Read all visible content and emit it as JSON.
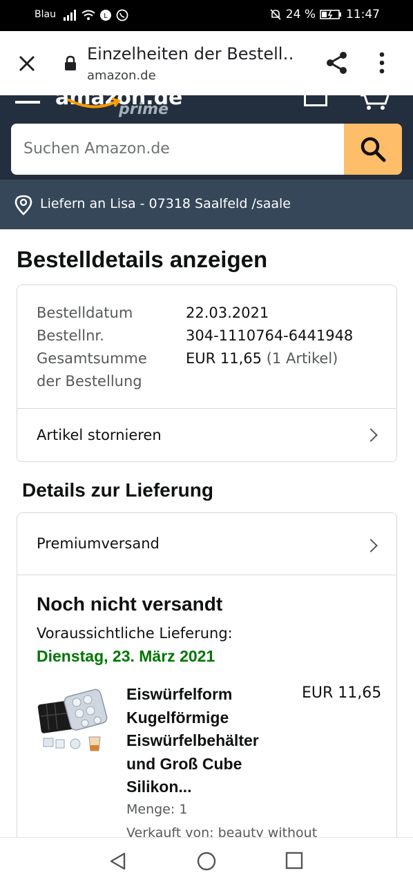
{
  "status_bar": {
    "carrier": "Blau",
    "battery": "24 %",
    "time": "11:47"
  },
  "browser": {
    "title": "Einzelheiten der Bestell…",
    "url": "amazon.de"
  },
  "header": {
    "logo": "amazon.de",
    "prime": "prime",
    "search_placeholder": "Suchen Amazon.de",
    "deliver_to": "Liefern an Lisa - 07318 Saalfeld /saale"
  },
  "page": {
    "title": "Bestelldetails anzeigen",
    "order": {
      "date_label": "Bestelldatum",
      "date_value": "22.03.2021",
      "number_label": "Bestellnr.",
      "number_value": "304-1110764-6441948",
      "total_label": "Gesamtsumme der Bestellung",
      "total_value": "EUR 11,65",
      "total_items": "(1 Artikel)"
    },
    "cancel_label": "Artikel stornieren",
    "delivery_section": "Details zur Lieferung",
    "shipping_method": "Premiumversand",
    "ship_status": "Noch nicht versandt",
    "estimated_label": "Voraussichtliche Lieferung:",
    "estimated_date": "Dienstag, 23. März 2021",
    "product": {
      "name": "Eiswürfelform Kugelförmige Eiswürfelbehälter und Groß Cube Silikon...",
      "price": "EUR 11,65",
      "quantity": "Menge: 1",
      "seller": "Verkauft von: beauty without"
    }
  },
  "colors": {
    "header_bg": "#232f3e",
    "deliver_bg": "#37475a",
    "search_button": "#febd69",
    "delivery_date": "#007600"
  }
}
